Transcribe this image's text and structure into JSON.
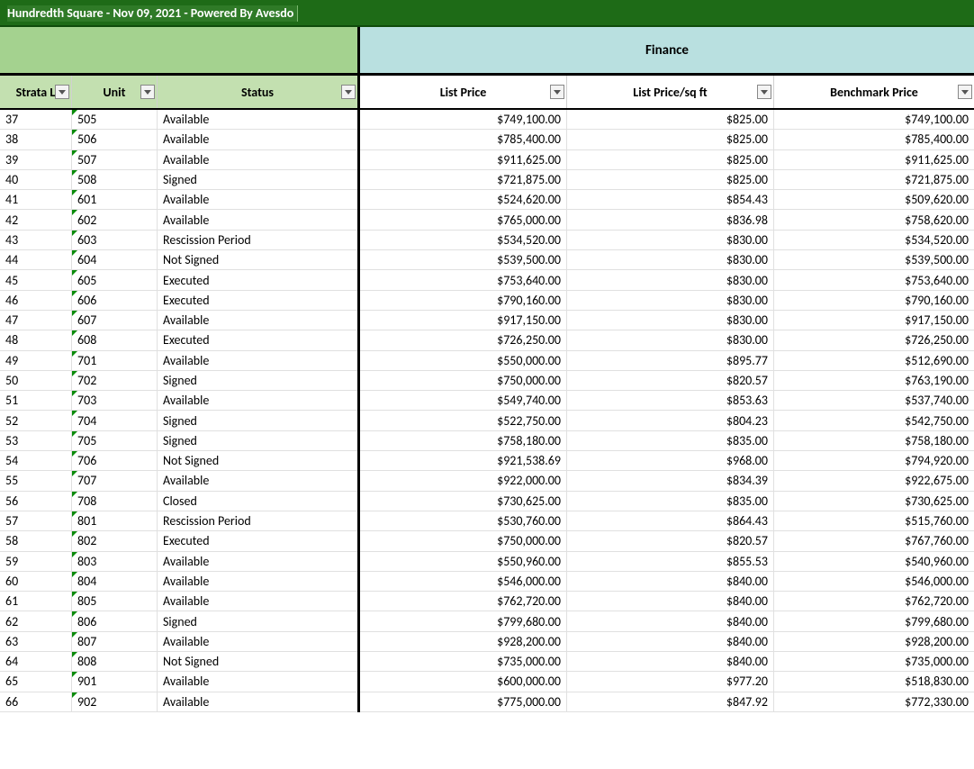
{
  "title": "Hundredth Square - Nov 09, 2021 - Powered By Avesdo",
  "groups": {
    "finance": "Finance"
  },
  "columns": {
    "strata": "Strata L",
    "unit": "Unit",
    "status": "Status",
    "list_price": "List Price",
    "list_price_sqft": "List Price/sq ft",
    "benchmark_price": "Benchmark Price"
  },
  "rows": [
    {
      "strata": "37",
      "unit": "505",
      "status": "Available",
      "lp": "$749,100.00",
      "lps": "$825.00",
      "bp": "$749,100.00"
    },
    {
      "strata": "38",
      "unit": "506",
      "status": "Available",
      "lp": "$785,400.00",
      "lps": "$825.00",
      "bp": "$785,400.00"
    },
    {
      "strata": "39",
      "unit": "507",
      "status": "Available",
      "lp": "$911,625.00",
      "lps": "$825.00",
      "bp": "$911,625.00"
    },
    {
      "strata": "40",
      "unit": "508",
      "status": "Signed",
      "lp": "$721,875.00",
      "lps": "$825.00",
      "bp": "$721,875.00"
    },
    {
      "strata": "41",
      "unit": "601",
      "status": "Available",
      "lp": "$524,620.00",
      "lps": "$854.43",
      "bp": "$509,620.00"
    },
    {
      "strata": "42",
      "unit": "602",
      "status": "Available",
      "lp": "$765,000.00",
      "lps": "$836.98",
      "bp": "$758,620.00"
    },
    {
      "strata": "43",
      "unit": "603",
      "status": "Rescission Period",
      "lp": "$534,520.00",
      "lps": "$830.00",
      "bp": "$534,520.00"
    },
    {
      "strata": "44",
      "unit": "604",
      "status": "Not Signed",
      "lp": "$539,500.00",
      "lps": "$830.00",
      "bp": "$539,500.00"
    },
    {
      "strata": "45",
      "unit": "605",
      "status": "Executed",
      "lp": "$753,640.00",
      "lps": "$830.00",
      "bp": "$753,640.00"
    },
    {
      "strata": "46",
      "unit": "606",
      "status": "Executed",
      "lp": "$790,160.00",
      "lps": "$830.00",
      "bp": "$790,160.00"
    },
    {
      "strata": "47",
      "unit": "607",
      "status": "Available",
      "lp": "$917,150.00",
      "lps": "$830.00",
      "bp": "$917,150.00"
    },
    {
      "strata": "48",
      "unit": "608",
      "status": "Executed",
      "lp": "$726,250.00",
      "lps": "$830.00",
      "bp": "$726,250.00"
    },
    {
      "strata": "49",
      "unit": "701",
      "status": "Available",
      "lp": "$550,000.00",
      "lps": "$895.77",
      "bp": "$512,690.00"
    },
    {
      "strata": "50",
      "unit": "702",
      "status": "Signed",
      "lp": "$750,000.00",
      "lps": "$820.57",
      "bp": "$763,190.00"
    },
    {
      "strata": "51",
      "unit": "703",
      "status": "Available",
      "lp": "$549,740.00",
      "lps": "$853.63",
      "bp": "$537,740.00"
    },
    {
      "strata": "52",
      "unit": "704",
      "status": "Signed",
      "lp": "$522,750.00",
      "lps": "$804.23",
      "bp": "$542,750.00"
    },
    {
      "strata": "53",
      "unit": "705",
      "status": "Signed",
      "lp": "$758,180.00",
      "lps": "$835.00",
      "bp": "$758,180.00"
    },
    {
      "strata": "54",
      "unit": "706",
      "status": "Not Signed",
      "lp": "$921,538.69",
      "lps": "$968.00",
      "bp": "$794,920.00"
    },
    {
      "strata": "55",
      "unit": "707",
      "status": "Available",
      "lp": "$922,000.00",
      "lps": "$834.39",
      "bp": "$922,675.00"
    },
    {
      "strata": "56",
      "unit": "708",
      "status": "Closed",
      "lp": "$730,625.00",
      "lps": "$835.00",
      "bp": "$730,625.00"
    },
    {
      "strata": "57",
      "unit": "801",
      "status": "Rescission Period",
      "lp": "$530,760.00",
      "lps": "$864.43",
      "bp": "$515,760.00"
    },
    {
      "strata": "58",
      "unit": "802",
      "status": "Executed",
      "lp": "$750,000.00",
      "lps": "$820.57",
      "bp": "$767,760.00"
    },
    {
      "strata": "59",
      "unit": "803",
      "status": "Available",
      "lp": "$550,960.00",
      "lps": "$855.53",
      "bp": "$540,960.00"
    },
    {
      "strata": "60",
      "unit": "804",
      "status": "Available",
      "lp": "$546,000.00",
      "lps": "$840.00",
      "bp": "$546,000.00"
    },
    {
      "strata": "61",
      "unit": "805",
      "status": "Available",
      "lp": "$762,720.00",
      "lps": "$840.00",
      "bp": "$762,720.00"
    },
    {
      "strata": "62",
      "unit": "806",
      "status": "Signed",
      "lp": "$799,680.00",
      "lps": "$840.00",
      "bp": "$799,680.00"
    },
    {
      "strata": "63",
      "unit": "807",
      "status": "Available",
      "lp": "$928,200.00",
      "lps": "$840.00",
      "bp": "$928,200.00"
    },
    {
      "strata": "64",
      "unit": "808",
      "status": "Not Signed",
      "lp": "$735,000.00",
      "lps": "$840.00",
      "bp": "$735,000.00"
    },
    {
      "strata": "65",
      "unit": "901",
      "status": "Available",
      "lp": "$600,000.00",
      "lps": "$977.20",
      "bp": "$518,830.00"
    },
    {
      "strata": "66",
      "unit": "902",
      "status": "Available",
      "lp": "$775,000.00",
      "lps": "$847.92",
      "bp": "$772,330.00"
    }
  ]
}
